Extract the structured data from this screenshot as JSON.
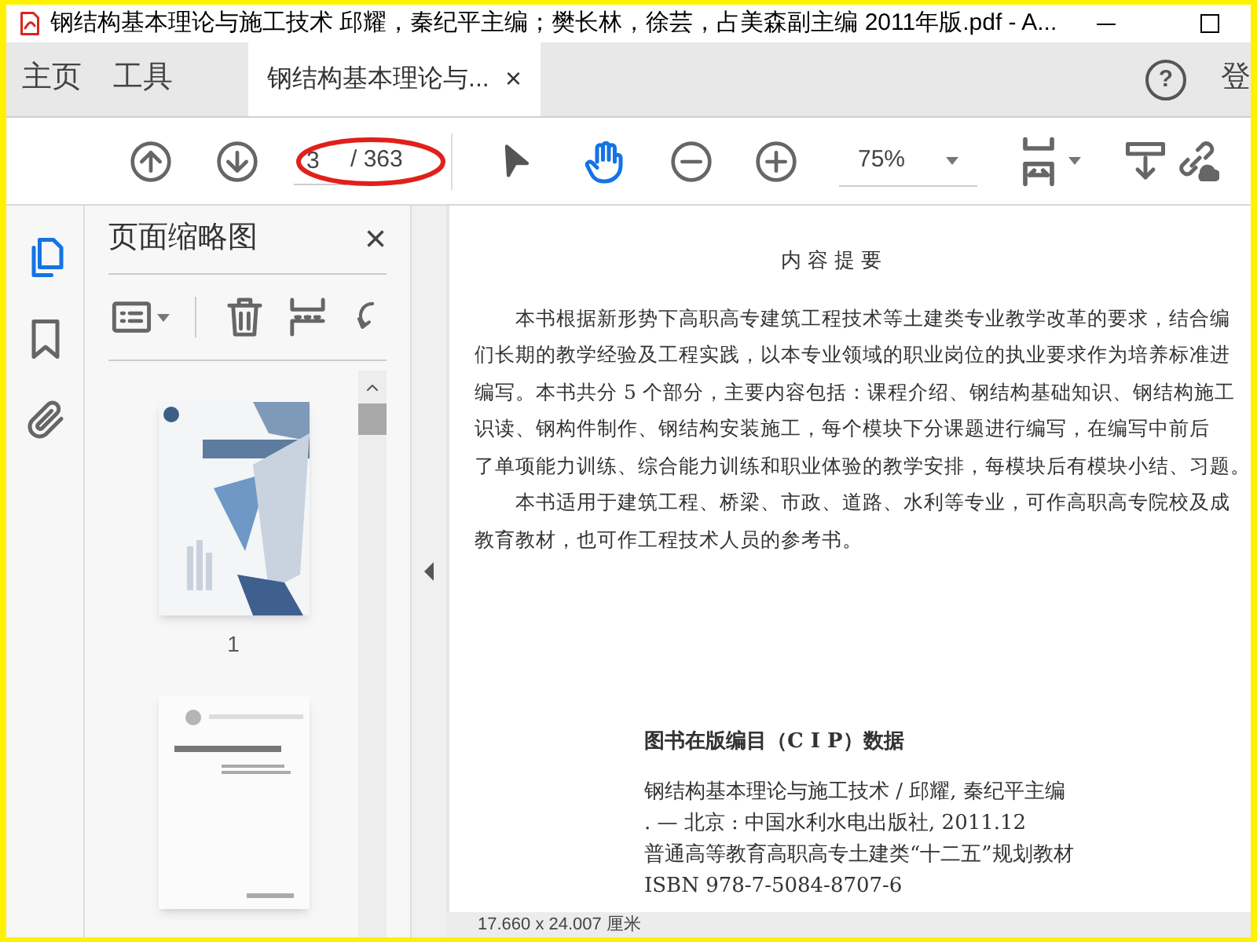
{
  "window": {
    "title": "钢结构基本理论与施工技术 邱耀，秦纪平主编；樊长林，徐芸，占美森副主编 2011年版.pdf - A..."
  },
  "nav_tabs": [
    {
      "label": "主页",
      "selected": false
    },
    {
      "label": "工具",
      "selected": false
    }
  ],
  "document_tab": {
    "label": "钢结构基本理论与...",
    "close": "×"
  },
  "right_label": "登",
  "help_symbol": "?",
  "toolbar": {
    "page_input": "3",
    "page_total": "/ 363",
    "zoom": "75%",
    "hand_tool_selected": true
  },
  "side_rail": [
    {
      "kind": "pages",
      "selected": true
    },
    {
      "kind": "bookmarks",
      "selected": false
    },
    {
      "kind": "attachments",
      "selected": false
    }
  ],
  "thumbnail_panel": {
    "title": "页面缩略图",
    "close": "×",
    "thumbnails": [
      {
        "kind": "cover",
        "label": "1"
      },
      {
        "kind": "title-page"
      }
    ]
  },
  "document": {
    "heading": "内 容 提 要",
    "lines": [
      {
        "text": "本书根据新形势下高职高专建筑工程技术等土建类专业教学改革的要求，结合编",
        "indent": true
      },
      {
        "text": "们长期的教学经验及工程实践，以本专业领域的职业岗位的执业要求作为培养标准进",
        "indent": false
      },
      {
        "text": "编写。本书共分 5 个部分，主要内容包括：课程介绍、钢结构基础知识、钢结构施工",
        "indent": false
      },
      {
        "text": "识读、钢构件制作、钢结构安装施工，每个模块下分课题进行编写，在编写中前后",
        "indent": false
      },
      {
        "text": "了单项能力训练、综合能力训练和职业体验的教学安排，每模块后有模块小结、习题。",
        "indent": false
      },
      {
        "text": "本书适用于建筑工程、桥梁、市政、道路、水利等专业，可作高职高专院校及成",
        "indent": true
      },
      {
        "text": "教育教材，也可作工程技术人员的参考书。",
        "indent": false
      }
    ],
    "cip_heading": "图书在版编目（C I P）数据",
    "cip_lines": [
      "钢结构基本理论与施工技术 / 邱耀, 秦纪平主编",
      ". — 北京 : 中国水利水电出版社, 2011.12",
      "普通高等教育高职高专土建类“十二五”规划教材",
      "ISBN 978-7-5084-8707-6"
    ]
  },
  "status_bar": {
    "size": "17.660 x 24.007 厘米"
  }
}
